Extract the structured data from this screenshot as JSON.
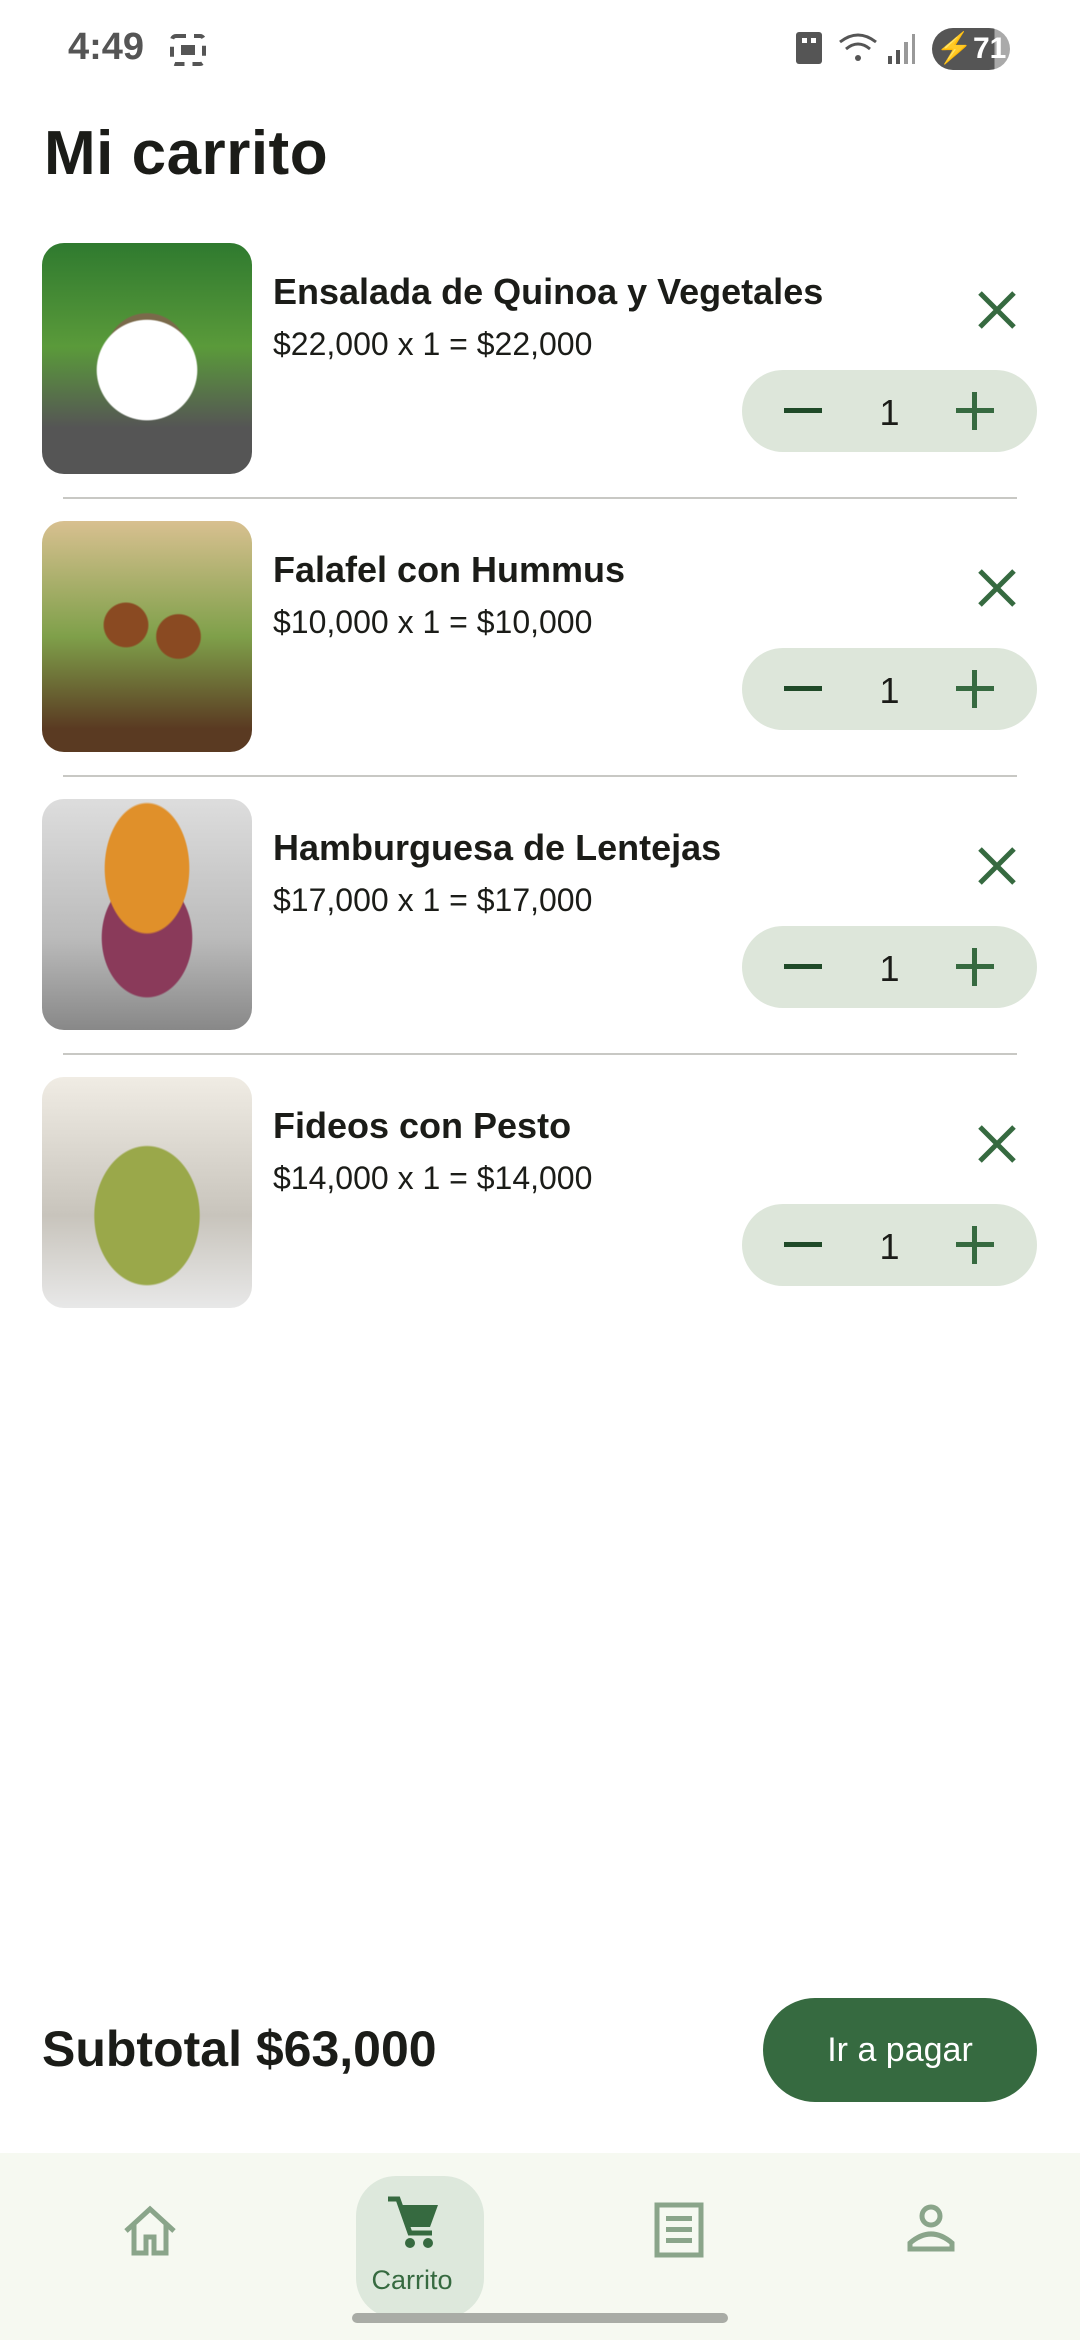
{
  "status_bar": {
    "time": "4:49",
    "battery": "71"
  },
  "title": "Mi carrito",
  "items": [
    {
      "name": "Ensalada de Quinoa y Vegetales",
      "price_line": "$22,000 x 1 = $22,000",
      "quantity": "1"
    },
    {
      "name": "Falafel con Hummus",
      "price_line": "$10,000 x 1 = $10,000",
      "quantity": "1"
    },
    {
      "name": "Hamburguesa de Lentejas",
      "price_line": "$17,000 x 1 = $17,000",
      "quantity": "1"
    },
    {
      "name": "Fideos con Pesto",
      "price_line": "$14,000 x 1 = $14,000",
      "quantity": "1"
    }
  ],
  "subtotal": "Subtotal $63,000",
  "checkout_label": "Ir a pagar",
  "nav": {
    "home": "",
    "cart": "Carrito",
    "orders": "",
    "profile": ""
  },
  "colors": {
    "primary": "#366a40",
    "stepper_bg": "#dde6da",
    "nav_bg": "#f6f9f1"
  }
}
